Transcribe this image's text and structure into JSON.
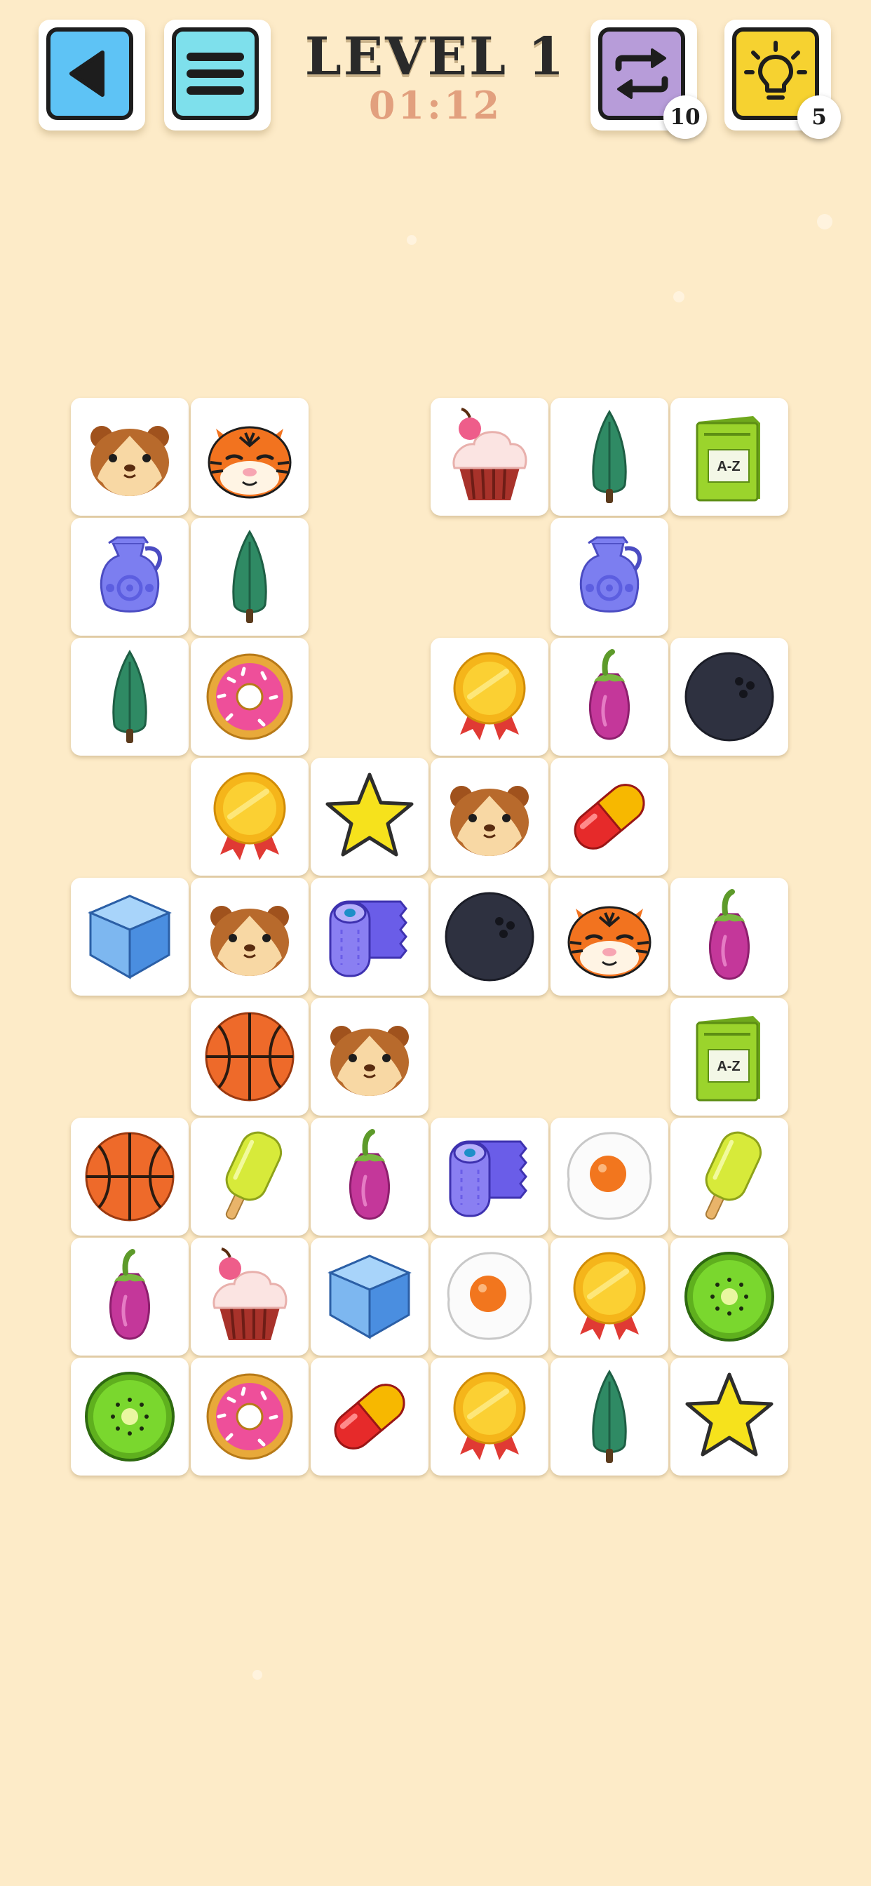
{
  "header": {
    "level_label": "LEVEL 1",
    "timer": "01:12",
    "back_icon": "back-arrow-icon",
    "menu_icon": "menu-icon",
    "shuffle_icon": "shuffle-icon",
    "shuffle_count": "10",
    "hint_icon": "lightbulb-icon",
    "hint_count": "5"
  },
  "colors": {
    "background": "#fdebc8",
    "back_button": "#5ec3f5",
    "menu_button": "#7ee0ec",
    "shuffle_button": "#b79cd9",
    "hint_button": "#f6d230",
    "title": "#2a2a2a",
    "timer": "#e2a07e"
  },
  "board": {
    "columns": 6,
    "rows": 9,
    "tiles": [
      {
        "row": 0,
        "col": 0,
        "icon": "hamster"
      },
      {
        "row": 0,
        "col": 1,
        "icon": "tiger"
      },
      {
        "row": 0,
        "col": 3,
        "icon": "cupcake"
      },
      {
        "row": 0,
        "col": 4,
        "icon": "cypress-tree"
      },
      {
        "row": 0,
        "col": 5,
        "icon": "dictionary-book",
        "label": "A-Z"
      },
      {
        "row": 1,
        "col": 0,
        "icon": "jug"
      },
      {
        "row": 1,
        "col": 1,
        "icon": "cypress-tree"
      },
      {
        "row": 1,
        "col": 4,
        "icon": "jug"
      },
      {
        "row": 2,
        "col": 0,
        "icon": "cypress-tree"
      },
      {
        "row": 2,
        "col": 1,
        "icon": "donut"
      },
      {
        "row": 2,
        "col": 3,
        "icon": "medal"
      },
      {
        "row": 2,
        "col": 4,
        "icon": "eggplant"
      },
      {
        "row": 2,
        "col": 5,
        "icon": "bowling-ball"
      },
      {
        "row": 3,
        "col": 1,
        "icon": "medal"
      },
      {
        "row": 3,
        "col": 2,
        "icon": "star"
      },
      {
        "row": 3,
        "col": 3,
        "icon": "hamster"
      },
      {
        "row": 3,
        "col": 4,
        "icon": "pill"
      },
      {
        "row": 4,
        "col": 0,
        "icon": "ice-cube"
      },
      {
        "row": 4,
        "col": 1,
        "icon": "hamster"
      },
      {
        "row": 4,
        "col": 2,
        "icon": "toilet-paper"
      },
      {
        "row": 4,
        "col": 3,
        "icon": "bowling-ball"
      },
      {
        "row": 4,
        "col": 4,
        "icon": "tiger"
      },
      {
        "row": 4,
        "col": 5,
        "icon": "eggplant"
      },
      {
        "row": 5,
        "col": 1,
        "icon": "basketball"
      },
      {
        "row": 5,
        "col": 2,
        "icon": "hamster"
      },
      {
        "row": 5,
        "col": 5,
        "icon": "dictionary-book",
        "label": "A-Z"
      },
      {
        "row": 6,
        "col": 0,
        "icon": "basketball"
      },
      {
        "row": 6,
        "col": 1,
        "icon": "popsicle"
      },
      {
        "row": 6,
        "col": 2,
        "icon": "eggplant"
      },
      {
        "row": 6,
        "col": 3,
        "icon": "toilet-paper"
      },
      {
        "row": 6,
        "col": 4,
        "icon": "fried-egg"
      },
      {
        "row": 6,
        "col": 5,
        "icon": "popsicle"
      },
      {
        "row": 7,
        "col": 0,
        "icon": "eggplant"
      },
      {
        "row": 7,
        "col": 1,
        "icon": "cupcake"
      },
      {
        "row": 7,
        "col": 2,
        "icon": "ice-cube"
      },
      {
        "row": 7,
        "col": 3,
        "icon": "fried-egg"
      },
      {
        "row": 7,
        "col": 4,
        "icon": "medal"
      },
      {
        "row": 7,
        "col": 5,
        "icon": "kiwi"
      },
      {
        "row": 8,
        "col": 0,
        "icon": "kiwi"
      },
      {
        "row": 8,
        "col": 1,
        "icon": "donut"
      },
      {
        "row": 8,
        "col": 2,
        "icon": "pill"
      },
      {
        "row": 8,
        "col": 3,
        "icon": "medal"
      },
      {
        "row": 8,
        "col": 4,
        "icon": "cypress-tree"
      },
      {
        "row": 8,
        "col": 5,
        "icon": "star"
      }
    ]
  }
}
